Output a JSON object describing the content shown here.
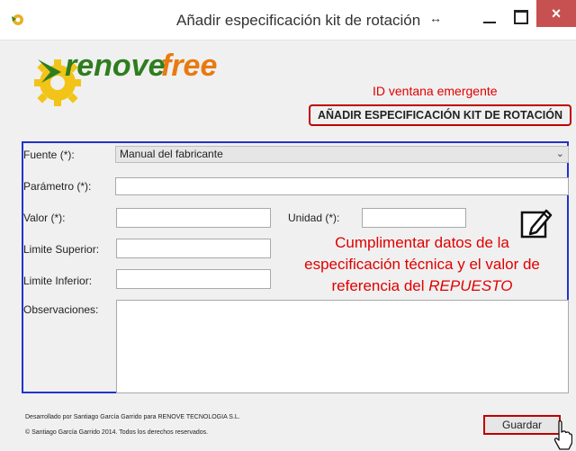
{
  "window": {
    "title": "Añadir especificación kit de rotación"
  },
  "logo": {
    "text_a": "renove",
    "text_b": "free"
  },
  "annotations": {
    "popup_id_label": "ID  ventana emergente",
    "popup_code": "AÑADIR ESPECIFICACIÓN KIT DE ROTACIÓN",
    "instruction_line1": "Cumplimentar datos de la",
    "instruction_line2": "especificación técnica y el valor de",
    "instruction_line3": "referencia del ",
    "instruction_emphasis": "REPUESTO"
  },
  "form": {
    "fuente_label": "Fuente (*):",
    "fuente_value": "Manual del fabricante",
    "parametro_label": "Parámetro (*):",
    "parametro_value": "",
    "valor_label": "Valor (*):",
    "valor_value": "",
    "unidad_label": "Unidad (*):",
    "unidad_value": "",
    "limite_superior_label": "Limite Superior:",
    "limite_superior_value": "",
    "limite_inferior_label": "Limite Inferior:",
    "limite_inferior_value": "",
    "observaciones_label": "Observaciones:",
    "observaciones_value": ""
  },
  "footer": {
    "developed_by": "Desarrollado por Santiago García Garrido para RENOVE TECNOLOGIA S.L.",
    "copyright": "© Santiago García Garrido 2014. Todos los derechos reservados."
  },
  "buttons": {
    "save": "Guardar",
    "close": "×"
  },
  "colors": {
    "annotation_red": "#e00000",
    "form_border_blue": "#2233cc",
    "logo_green": "#2e7d1e",
    "logo_orange": "#e87a10",
    "gear_yellow": "#f2c418"
  }
}
